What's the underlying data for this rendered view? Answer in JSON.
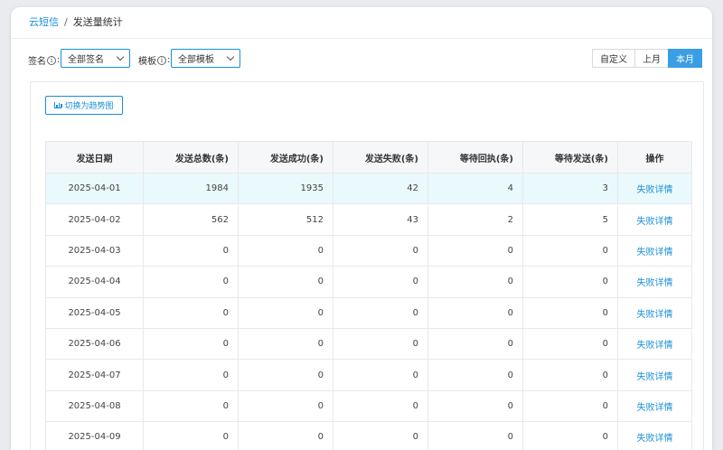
{
  "breadcrumb": {
    "parent": "云短信",
    "separator": "/",
    "current": "发送量统计"
  },
  "filters": {
    "signature_label": "签名",
    "signature_value": "全部签名",
    "template_label": "模板",
    "template_value": "全部模板",
    "info_glyph": "i",
    "colon": ":"
  },
  "range_buttons": [
    "自定义",
    "上月",
    "本月"
  ],
  "active_range": "本月",
  "trend_button_label": "切换为趋势图",
  "table": {
    "headers": [
      "发送日期",
      "发送总数(条)",
      "发送成功(条)",
      "发送失败(条)",
      "等待回执(条)",
      "等待发送(条)",
      "操作"
    ],
    "rows": [
      {
        "date": "2025-04-01",
        "total": "1984",
        "success": "1935",
        "failed": "42",
        "receipt": "4",
        "pending": "3",
        "action": "失败详情"
      },
      {
        "date": "2025-04-02",
        "total": "562",
        "success": "512",
        "failed": "43",
        "receipt": "2",
        "pending": "5",
        "action": "失败详情"
      },
      {
        "date": "2025-04-03",
        "total": "0",
        "success": "0",
        "failed": "0",
        "receipt": "0",
        "pending": "0",
        "action": "失败详情"
      },
      {
        "date": "2025-04-04",
        "total": "0",
        "success": "0",
        "failed": "0",
        "receipt": "0",
        "pending": "0",
        "action": "失败详情"
      },
      {
        "date": "2025-04-05",
        "total": "0",
        "success": "0",
        "failed": "0",
        "receipt": "0",
        "pending": "0",
        "action": "失败详情"
      },
      {
        "date": "2025-04-06",
        "total": "0",
        "success": "0",
        "failed": "0",
        "receipt": "0",
        "pending": "0",
        "action": "失败详情"
      },
      {
        "date": "2025-04-07",
        "total": "0",
        "success": "0",
        "failed": "0",
        "receipt": "0",
        "pending": "0",
        "action": "失败详情"
      },
      {
        "date": "2025-04-08",
        "total": "0",
        "success": "0",
        "failed": "0",
        "receipt": "0",
        "pending": "0",
        "action": "失败详情"
      },
      {
        "date": "2025-04-09",
        "total": "0",
        "success": "0",
        "failed": "0",
        "receipt": "0",
        "pending": "0",
        "action": "失败详情"
      }
    ]
  },
  "colors": {
    "accent": "#1a8fd8",
    "active_button": "#3a9ee4",
    "highlight_row": "#eaf9fb"
  }
}
